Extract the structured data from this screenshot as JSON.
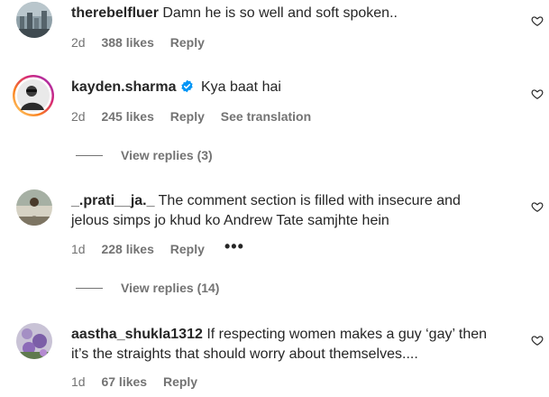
{
  "comments": [
    {
      "username": "therebelfluer",
      "text": "Damn he is so well and soft spoken..",
      "age": "2d",
      "likes": "388 likes",
      "reply": "Reply"
    },
    {
      "username": "kayden.sharma",
      "verified": true,
      "text": "Kya baat hai",
      "age": "2d",
      "likes": "245 likes",
      "reply": "Reply",
      "translation": "See translation",
      "view_replies": "View replies (3)"
    },
    {
      "username": "_.prati__ja._",
      "text_line1": "The comment section is filled with insecure and",
      "text_line2": "jelous simps jo khud ko Andrew Tate samjhte hein",
      "age": "1d",
      "likes": "228 likes",
      "reply": "Reply",
      "more": "•••",
      "view_replies": "View replies (14)"
    },
    {
      "username": "aastha_shukla1312",
      "text_line1": "If respecting women makes a guy ‘gay’ then",
      "text_line2": "it’s the straights that should worry about themselves....",
      "age": "1d",
      "likes": "67 likes",
      "reply": "Reply"
    }
  ],
  "icons": {
    "like": "heart-outline-icon",
    "verified": "verified-badge-icon",
    "more": "more-options-icon"
  },
  "colors": {
    "text": "#262626",
    "secondary": "#737373",
    "verified": "#0095f6",
    "story_ring": "#d62976"
  }
}
